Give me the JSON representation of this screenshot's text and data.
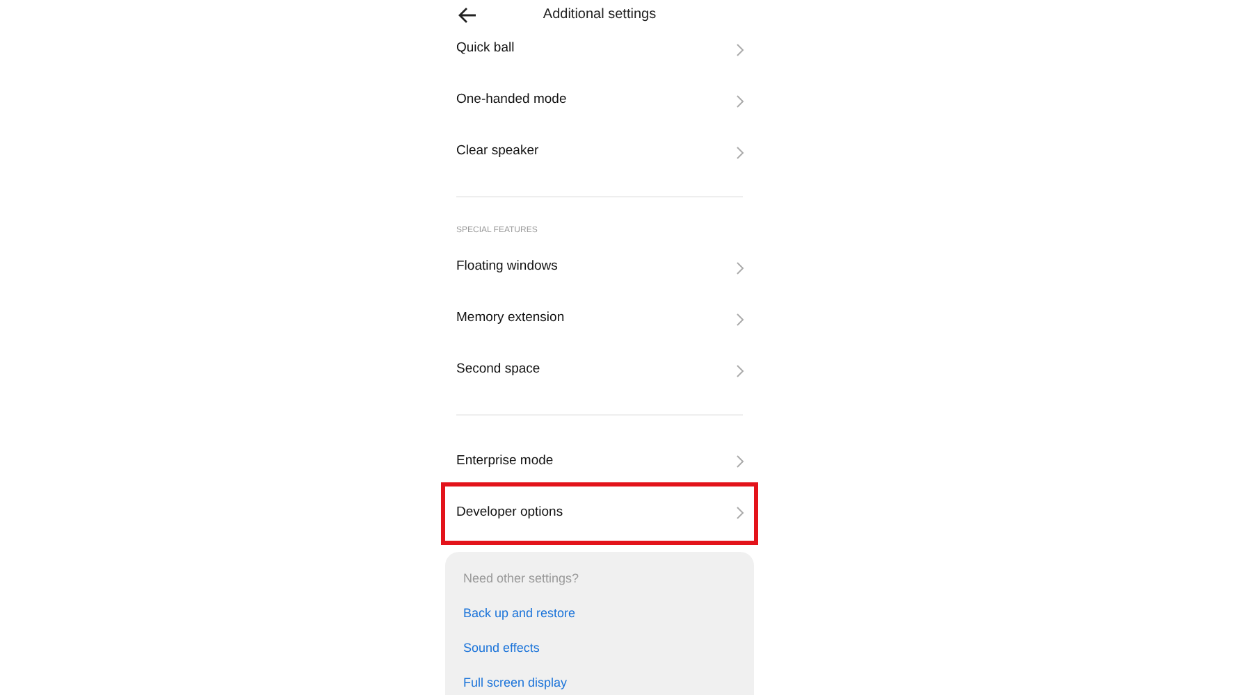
{
  "header": {
    "title": "Additional settings"
  },
  "groups": [
    {
      "items": [
        {
          "label": "Quick ball",
          "highlighted": false
        },
        {
          "label": "One-handed mode",
          "highlighted": false
        },
        {
          "label": "Clear speaker",
          "highlighted": false
        }
      ]
    },
    {
      "heading": "SPECIAL FEATURES",
      "items": [
        {
          "label": "Floating windows",
          "highlighted": false
        },
        {
          "label": "Memory extension",
          "highlighted": false
        },
        {
          "label": "Second space",
          "highlighted": false
        }
      ]
    },
    {
      "items": [
        {
          "label": "Enterprise mode",
          "highlighted": false
        },
        {
          "label": "Developer options",
          "highlighted": true
        }
      ]
    }
  ],
  "suggestions": {
    "title": "Need other settings?",
    "links": [
      "Back up and restore",
      "Sound effects",
      "Full screen display"
    ]
  }
}
